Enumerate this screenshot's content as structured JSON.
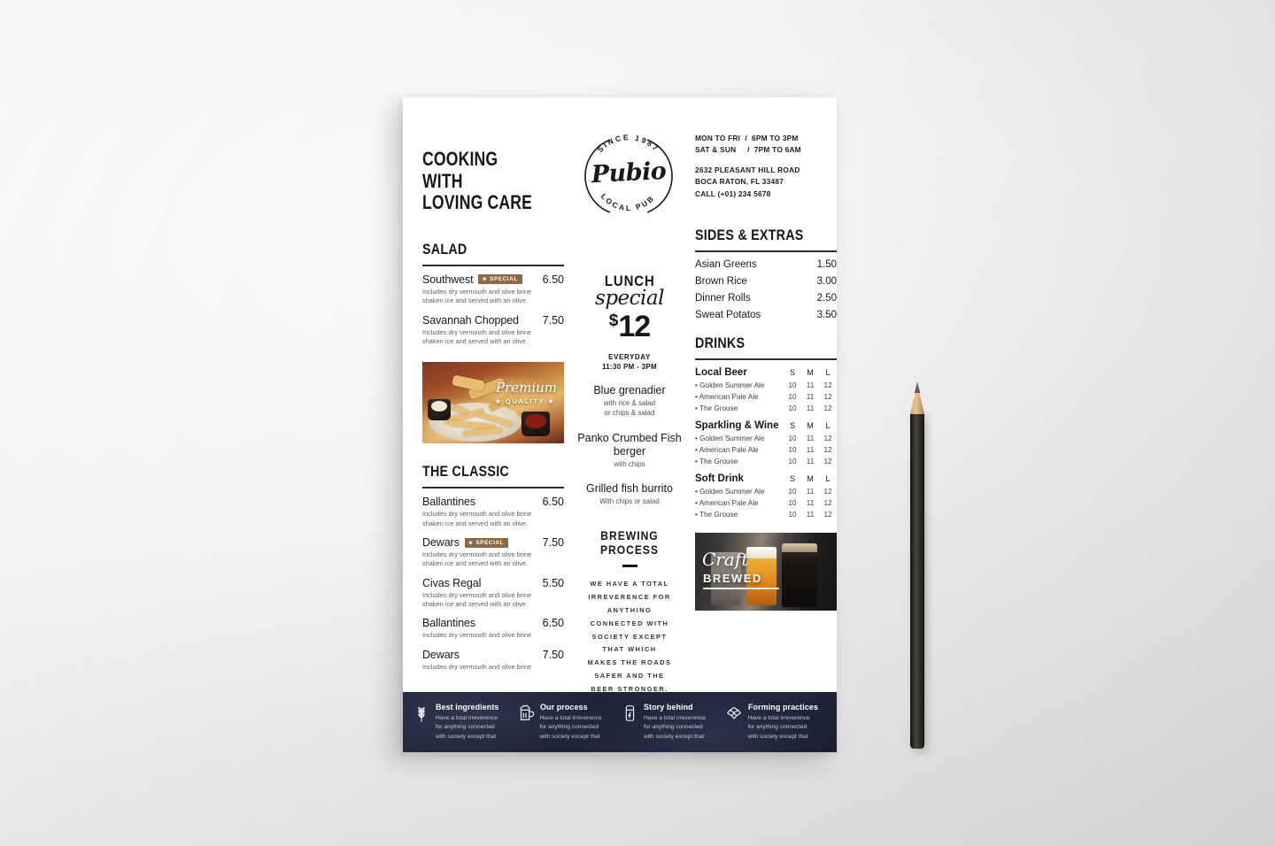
{
  "poster": {
    "headline": "COOKING WITH\nLOVING CARE",
    "logo": {
      "top_text": "SINCE 1987",
      "bottom_text": "LOCAL PUB",
      "name": "Pubio"
    },
    "contact": {
      "hours_line_1": "MON TO FRI  /  6PM TO 3PM",
      "hours_line_2": "SAT & SUN     /  7PM TO 6AM",
      "address_line_1": "2632 PLEASANT HILL ROAD",
      "address_line_2": "BOCA RATON, FL 33487",
      "phone": "CALL (+01) 234 5678"
    },
    "salad": {
      "title": "SALAD",
      "items": [
        {
          "name": "Southwest",
          "badge": "SPECIAL",
          "price": "6.50",
          "desc": "Includes dry vermouth and olive brine\nshaken ice and served with an olive."
        },
        {
          "name": "Savannah Chopped",
          "badge": "",
          "price": "7.50",
          "desc": "Includes dry vermouth and olive brine\nshaken ice and served with an olive."
        }
      ]
    },
    "food_photo": {
      "overlay_script": "Premium",
      "overlay_sub": "★ QUALITY ★"
    },
    "classic": {
      "title": "THE CLASSIC",
      "items": [
        {
          "name": "Ballantines",
          "badge": "",
          "price": "6.50",
          "desc": "Includes dry vermouth and olive brine\nshaken ice and served with an olive."
        },
        {
          "name": "Dewars",
          "badge": "SPECIAL",
          "price": "7.50",
          "desc": "Includes dry vermouth and olive brine\nshaken ice and served with an olive."
        },
        {
          "name": "Civas Regal",
          "badge": "",
          "price": "5.50",
          "desc": "Includes dry vermouth and olive brine\nshaken ice and served with an olive."
        },
        {
          "name": "Ballantines",
          "badge": "",
          "price": "6.50",
          "desc": "Includes dry vermouth and olive brine"
        },
        {
          "name": "Dewars",
          "badge": "",
          "price": "7.50",
          "desc": "Includes dry vermouth and olive brine"
        }
      ]
    },
    "lunch": {
      "word": "LUNCH",
      "script": "special",
      "currency": "$",
      "price": "12",
      "when": "EVERYDAY",
      "hours": "11:30 PM - 3PM",
      "dishes": [
        {
          "name": "Blue grenadier",
          "note": "with rice & salad\nor chips & salad"
        },
        {
          "name": "Panko Crumbed\nFish berger",
          "note": "with chips"
        },
        {
          "name": "Grilled fish burrito",
          "note": "With chips or salad"
        }
      ]
    },
    "brewing": {
      "title": "BREWING\nPROCESS",
      "text": "WE HAVE A TOTAL\nIRREVERENCE FOR\nANYTHING\nCONNECTED WITH\nSOCIETY EXCEPT\nTHAT WHICH\nMAKES THE ROADS\nSAFER AND THE\nBEER STRONGER."
    },
    "sides": {
      "title": "SIDES & EXTRAS",
      "items": [
        {
          "name": "Asian Greens",
          "price": "1.50"
        },
        {
          "name": "Brown Rice",
          "price": "3.00"
        },
        {
          "name": "Dinner Rolls",
          "price": "2.50"
        },
        {
          "name": "Sweat Potatos",
          "price": "3.50"
        }
      ]
    },
    "drinks": {
      "title": "DRINKS",
      "size_headers": [
        "S",
        "M",
        "L"
      ],
      "groups": [
        {
          "name": "Local Beer",
          "rows": [
            {
              "name": "Golden Summer Ale",
              "prices": [
                "10",
                "11",
                "12"
              ]
            },
            {
              "name": "American Pale Ale",
              "prices": [
                "10",
                "11",
                "12"
              ]
            },
            {
              "name": "The Grouse",
              "prices": [
                "10",
                "11",
                "12"
              ]
            }
          ]
        },
        {
          "name": "Sparkling & Wine",
          "rows": [
            {
              "name": "Golden Summer Ale",
              "prices": [
                "10",
                "11",
                "12"
              ]
            },
            {
              "name": "American Pale Ale",
              "prices": [
                "10",
                "11",
                "12"
              ]
            },
            {
              "name": "The Grouse",
              "prices": [
                "10",
                "11",
                "12"
              ]
            }
          ]
        },
        {
          "name": "Soft Drink",
          "rows": [
            {
              "name": "Golden Summer Ale",
              "prices": [
                "10",
                "11",
                "12"
              ]
            },
            {
              "name": "American Pale Ale",
              "prices": [
                "10",
                "11",
                "12"
              ]
            },
            {
              "name": "The Grouse",
              "prices": [
                "10",
                "11",
                "12"
              ]
            }
          ]
        }
      ]
    },
    "beer_photo": {
      "overlay_script": "Craft",
      "overlay_sub": "BREWED"
    },
    "footer": {
      "cells": [
        {
          "icon": "wheat-icon",
          "title": "Best ingredients",
          "text": "Have a total irreverence\nfor anything connected\nwith society except that"
        },
        {
          "icon": "beer-mug-icon",
          "title": "Our process",
          "text": "Have a total irreverence\nfor anything connected\nwith society except that"
        },
        {
          "icon": "beer-can-icon",
          "title": "Story behind",
          "text": "Have a total irreverence\nfor anything connected\nwith society except that"
        },
        {
          "icon": "hop-icon",
          "title": "Forming practices",
          "text": "Have a total irreverence\nfor anything connected\nwith society except that"
        }
      ]
    },
    "colors": {
      "badge": "#8b6a45",
      "footer_bg": "#1d2337",
      "ink": "#16171c"
    }
  }
}
